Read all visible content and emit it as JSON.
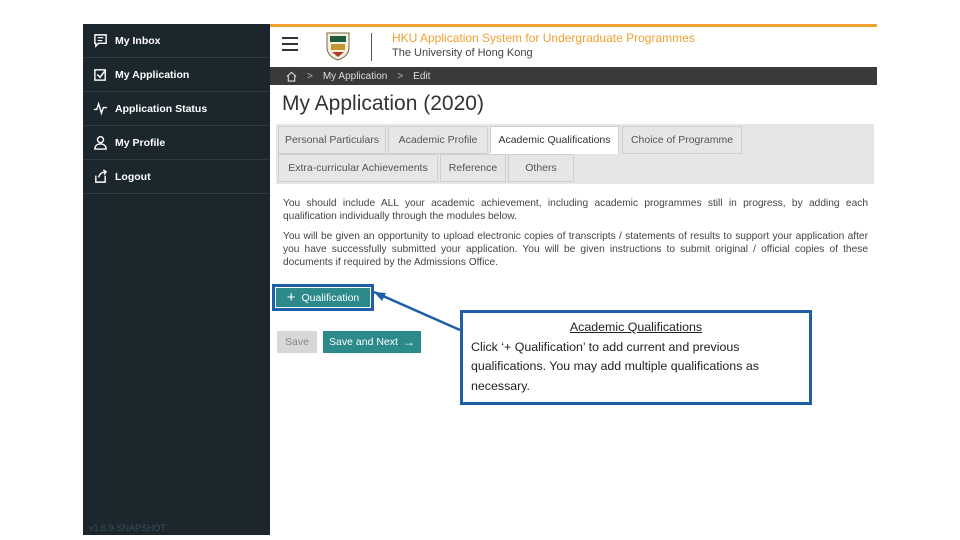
{
  "sidebar": {
    "items": [
      {
        "label": "My Inbox",
        "icon": "chat-icon"
      },
      {
        "label": "My Application",
        "icon": "checkbox-icon"
      },
      {
        "label": "Application Status",
        "icon": "pulse-icon"
      },
      {
        "label": "My Profile",
        "icon": "user-icon"
      },
      {
        "label": "Logout",
        "icon": "logout-icon"
      }
    ],
    "version": "v1.6.9-SNAPSHOT"
  },
  "header": {
    "title": "HKU Application System for Undergraduate Programmes",
    "subtitle": "The University of Hong Kong"
  },
  "breadcrumb": {
    "items": [
      "My Application",
      "Edit"
    ]
  },
  "page": {
    "title": "My Application (2020)"
  },
  "tabs": [
    {
      "label": "Personal Particulars",
      "active": false
    },
    {
      "label": "Academic Profile",
      "active": false
    },
    {
      "label": "Academic Qualifications",
      "active": true
    },
    {
      "label": "Choice of Programme",
      "active": false
    },
    {
      "label": "Extra-curricular Achievements",
      "active": false
    },
    {
      "label": "Reference",
      "active": false
    },
    {
      "label": "Others",
      "active": false
    }
  ],
  "content": {
    "para1": "You should include ALL your academic achievement, including academic programmes still in progress, by adding each qualification individually through the modules below.",
    "para2": "You will be given an opportunity to upload electronic copies of transcripts / statements of results to support your application after you have successfully submitted your application. You will be given instructions to submit original / official copies of these documents if required by the Admissions Office."
  },
  "buttons": {
    "add_qualification": "Qualification",
    "save": "Save",
    "save_and_next": "Save and Next"
  },
  "callout": {
    "title": "Academic Qualifications",
    "body": "Click ‘+ Qualification’ to add current and previous qualifications.  You may add multiple qualifications as necessary."
  },
  "colors": {
    "accent": "#f0a030",
    "sidebar": "#1c262d",
    "button": "#2c8a8a",
    "callout_border": "#1f5fa8"
  }
}
